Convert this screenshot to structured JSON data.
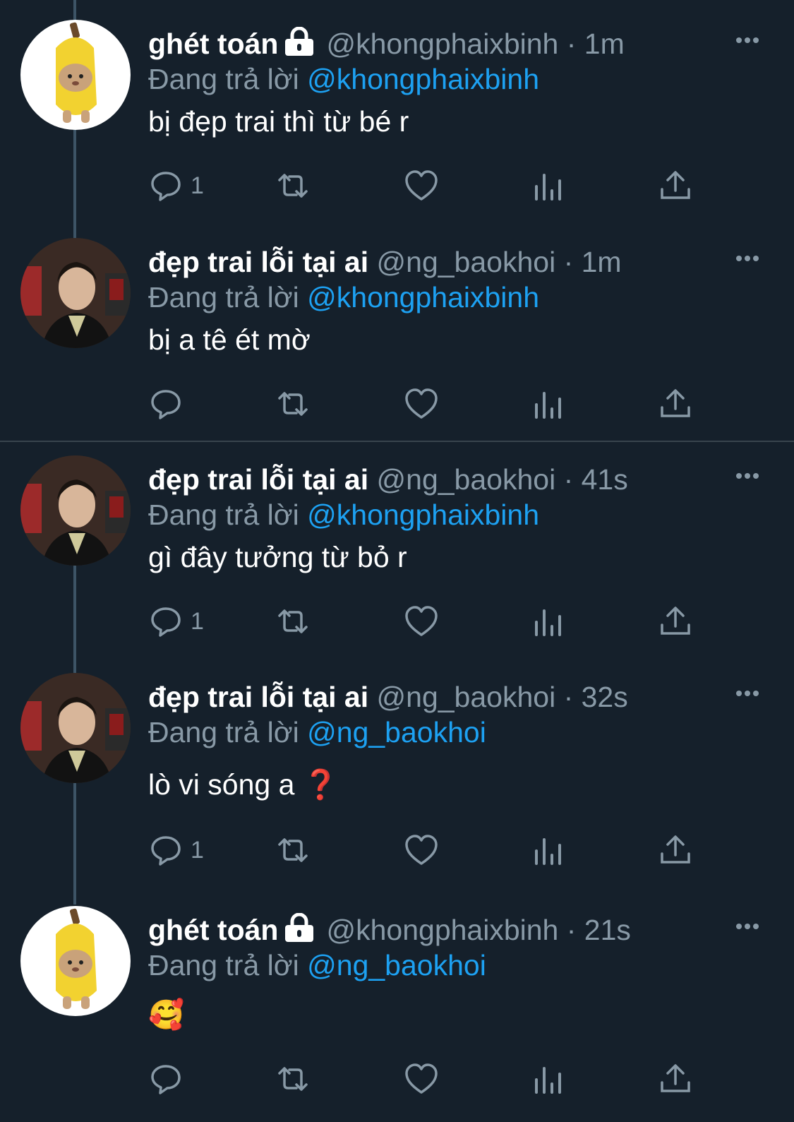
{
  "replying_label": "Đang trả lời",
  "tweets": [
    {
      "name": "ghét toán",
      "locked": true,
      "handle": "@khongphaixbinh",
      "time": "1m",
      "reply_to": "@khongphaixbinh",
      "text": "bị đẹp trai thì từ bé r",
      "reply_count": "1",
      "avatar": "banana-cat"
    },
    {
      "name": "đẹp trai lỗi tại ai",
      "locked": false,
      "handle": "@ng_baokhoi",
      "time": "1m",
      "reply_to": "@khongphaixbinh",
      "text": "bị a tê ét mờ",
      "reply_count": "",
      "avatar": "boy-photo"
    },
    {
      "name": "đẹp trai lỗi tại ai",
      "locked": false,
      "handle": "@ng_baokhoi",
      "time": "41s",
      "reply_to": "@khongphaixbinh",
      "text": "gì đây tưởng từ bỏ r",
      "reply_count": "1",
      "avatar": "boy-photo"
    },
    {
      "name": "đẹp trai lỗi tại ai",
      "locked": false,
      "handle": "@ng_baokhoi",
      "time": "32s",
      "reply_to": "@ng_baokhoi",
      "text": "lò vi sóng a ❓",
      "reply_count": "1",
      "avatar": "boy-photo"
    },
    {
      "name": "ghét toán",
      "locked": true,
      "handle": "@khongphaixbinh",
      "time": "21s",
      "reply_to": "@ng_baokhoi",
      "text": "🥰",
      "reply_count": "",
      "avatar": "banana-cat"
    }
  ],
  "colors": {
    "background": "#15202b",
    "muted": "#8899a6",
    "accent": "#1da1f2",
    "thread_line": "#3d5466"
  },
  "icons": [
    "reply-icon",
    "retweet-icon",
    "like-icon",
    "views-icon",
    "share-icon",
    "more-icon",
    "lock-icon"
  ]
}
